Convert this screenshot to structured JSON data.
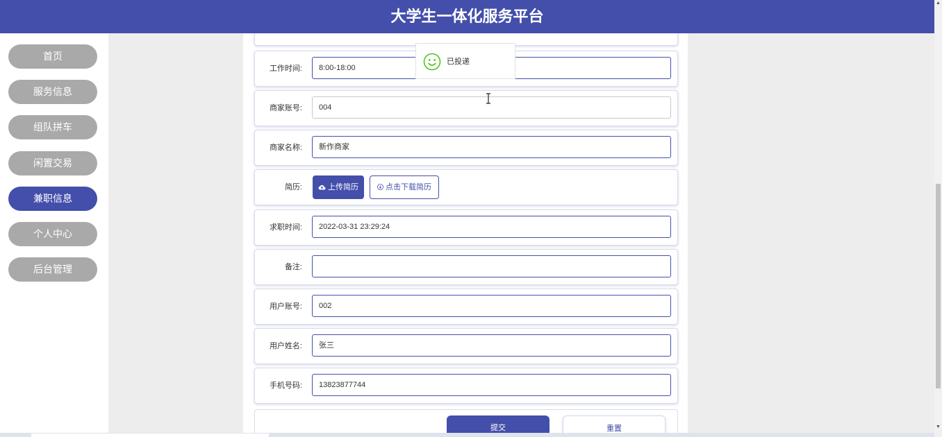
{
  "header": {
    "title": "大学生一体化服务平台"
  },
  "sidebar": {
    "items": [
      {
        "label": "首页",
        "active": false
      },
      {
        "label": "服务信息",
        "active": false
      },
      {
        "label": "组队拼车",
        "active": false
      },
      {
        "label": "闲置交易",
        "active": false
      },
      {
        "label": "兼职信息",
        "active": true
      },
      {
        "label": "个人中心",
        "active": false
      },
      {
        "label": "后台管理",
        "active": false
      }
    ]
  },
  "form": {
    "work_time": {
      "label": "工作时间:",
      "value": "8:00-18:00"
    },
    "merchant_account": {
      "label": "商家账号:",
      "value": "004"
    },
    "merchant_name": {
      "label": "商家名称:",
      "value": "新作商家"
    },
    "resume": {
      "label": "简历:",
      "upload_label": "上传简历",
      "download_label": "点击下载简历"
    },
    "apply_time": {
      "label": "求职时间:",
      "value": "2022-03-31 23:29:24"
    },
    "remark": {
      "label": "备注:",
      "value": ""
    },
    "user_account": {
      "label": "用户账号:",
      "value": "002"
    },
    "user_name": {
      "label": "用户姓名:",
      "value": "张三"
    },
    "phone": {
      "label": "手机号码:",
      "value": "13823877744"
    },
    "submit_label": "提交",
    "reset_label": "重置"
  },
  "toast": {
    "text": "已投递",
    "icon": "smiley-icon"
  },
  "colors": {
    "primary": "#434faa",
    "nav_inactive": "#a9a9a9",
    "success": "#52c41a",
    "background": "#ededed"
  }
}
